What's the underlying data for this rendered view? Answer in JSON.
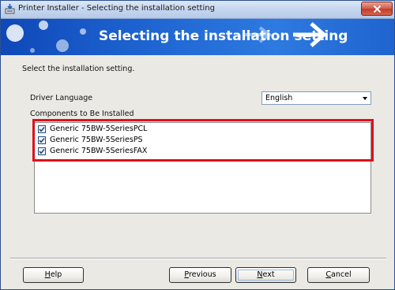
{
  "window": {
    "title": "Printer Installer - Selecting the installation setting"
  },
  "banner": {
    "title": "Selecting the installation setting"
  },
  "main": {
    "instruction": "Select the installation setting.",
    "driver_language_label": "Driver Language",
    "driver_language_value": "English",
    "components_label": "Components to Be Installed",
    "components": [
      {
        "label": "Generic 75BW-5SeriesPCL",
        "checked": true
      },
      {
        "label": "Generic 75BW-5SeriesPS",
        "checked": true
      },
      {
        "label": "Generic 75BW-5SeriesFAX",
        "checked": true
      }
    ]
  },
  "buttons": {
    "help": {
      "accel": "H",
      "rest": "elp"
    },
    "previous": {
      "accel": "P",
      "rest": "revious"
    },
    "next": {
      "accel": "N",
      "rest": "ext"
    },
    "cancel": {
      "accel": "C",
      "rest": "ancel"
    }
  },
  "colors": {
    "highlight": "#e0101a",
    "banner": "#1d63d0"
  }
}
